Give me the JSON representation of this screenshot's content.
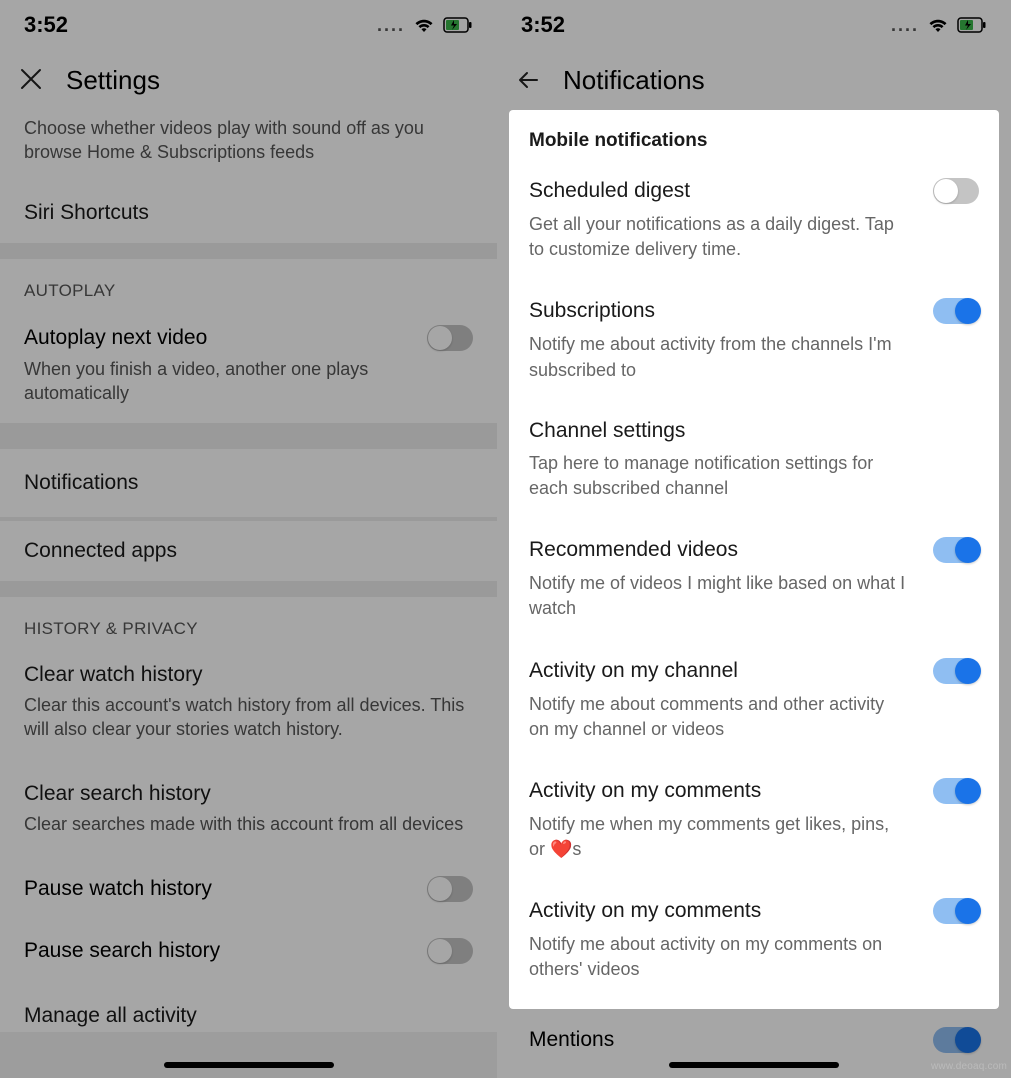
{
  "status": {
    "time": "3:52"
  },
  "left": {
    "header_title": "Settings",
    "intro_desc": "Choose whether videos play with sound off as you browse Home & Subscriptions feeds",
    "siri": "Siri Shortcuts",
    "autoplay_header": "AUTOPLAY",
    "autoplay_title": "Autoplay next video",
    "autoplay_desc": "When you finish a video, another one plays automatically",
    "notifications": "Notifications",
    "connected_apps": "Connected apps",
    "history_header": "HISTORY & PRIVACY",
    "clear_watch_title": "Clear watch history",
    "clear_watch_desc": "Clear this account's watch history from all devices. This will also clear your stories watch history.",
    "clear_search_title": "Clear search history",
    "clear_search_desc": "Clear searches made with this account from all devices",
    "pause_watch": "Pause watch history",
    "pause_search": "Pause search history",
    "manage_all": "Manage all activity"
  },
  "right": {
    "header_title": "Notifications",
    "section_title": "Mobile notifications",
    "items": [
      {
        "title": "Scheduled digest",
        "desc": "Get all your notifications as a daily digest. Tap to customize delivery time.",
        "toggle": "off"
      },
      {
        "title": "Subscriptions",
        "desc": "Notify me about activity from the channels I'm subscribed to",
        "toggle": "on"
      },
      {
        "title": "Channel settings",
        "desc": "Tap here to manage notification settings for each subscribed channel",
        "toggle": "none"
      },
      {
        "title": "Recommended videos",
        "desc": "Notify me of videos I might like based on what I watch",
        "toggle": "on"
      },
      {
        "title": "Activity on my channel",
        "desc": "Notify me about comments and other activity on my channel or videos",
        "toggle": "on"
      },
      {
        "title": "Activity on my comments",
        "desc": "Notify me when my comments get likes, pins, or ❤️s",
        "toggle": "on"
      },
      {
        "title": "Activity on my comments",
        "desc": "Notify me about activity on my comments on others' videos",
        "toggle": "on"
      }
    ],
    "mentions": "Mentions"
  },
  "watermark": "www.deoaq.com"
}
